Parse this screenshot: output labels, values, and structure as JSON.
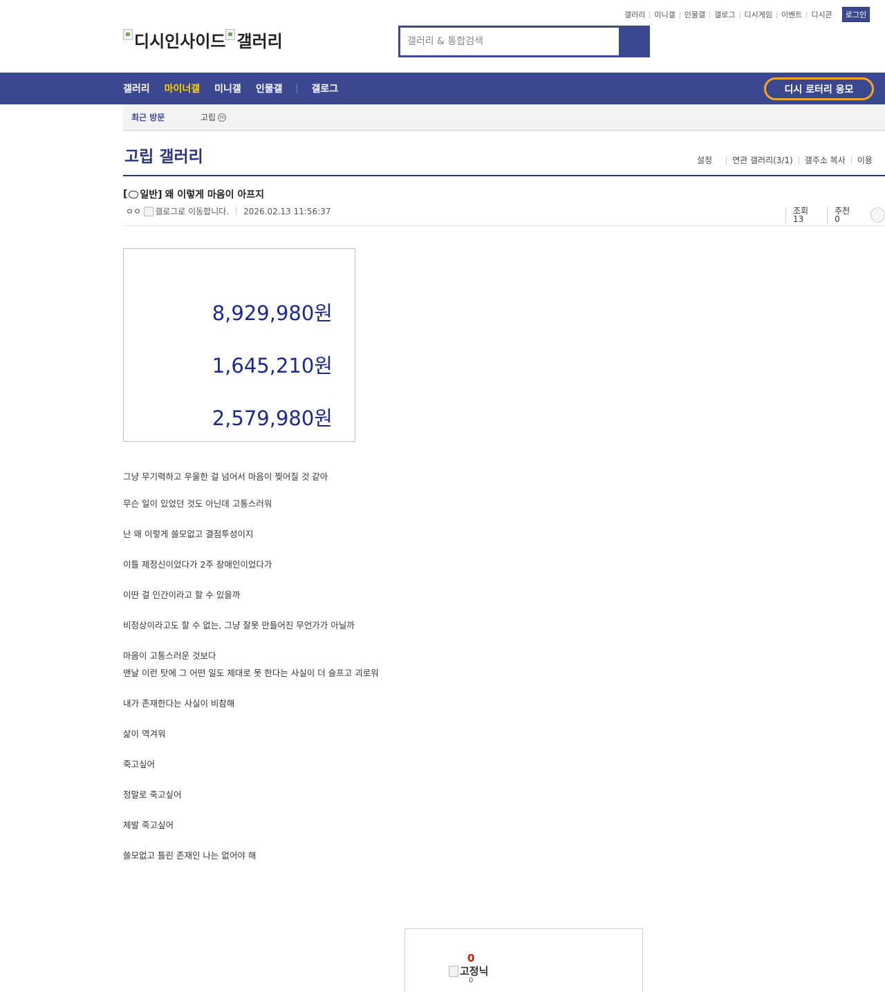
{
  "top_links": [
    "갤러리",
    "미니갤",
    "인물갤",
    "갤로그",
    "디시게임",
    "이벤트",
    "디시콘"
  ],
  "login_label": "로그인",
  "logo": {
    "site": "디시인사이드",
    "section": "갤러리"
  },
  "search": {
    "placeholder": "갤러리 & 통합검색"
  },
  "nav": {
    "items": [
      "갤러리",
      "마이너갤",
      "미니갤",
      "인물갤"
    ],
    "gallog": "갤로그",
    "lottery": "디시 로터리 응모"
  },
  "recent": {
    "label": "최근 방문",
    "item": "고립",
    "badge": "m"
  },
  "gallery": {
    "title": "고립 갤러리",
    "tools": [
      "설정",
      "연관 갤러리(3/1)",
      "갤주소 복사",
      "이용"
    ]
  },
  "post": {
    "category_open": "[",
    "category": "일반]",
    "title": "왜 이렇게 마음이 아프지",
    "writer": "ㅇㅇ",
    "gallog_alt": "갤로그로 이동합니다.",
    "date": "2026.02.13 11:56:37",
    "views": "조회 13",
    "recommend": "추천 0"
  },
  "image_amounts": [
    "8,929,980원",
    "1,645,210원",
    "2,579,980원"
  ],
  "body_lines": [
    "그냥 무기력하고 우울한 걸 넘어서 마음이 찢어질 것 같아",
    "무슨 일이 있었던 것도 아닌데 고통스러워",
    "난 왜 이렇게 쓸모없고 결점투성이지",
    "이틀 제정신이었다가 2주 장애인이었다가",
    "이딴 걸 인간이라고 할 수 있을까",
    "비정상이라고도 할 수 없는, 그냥 잘못 만들어진 무언가가 아닐까",
    "마음이 고통스러운 것보다",
    "맨날 이런 탓에 그 어떤 일도 제대로 못 한다는 사실이 더 슬프고 괴로워",
    "내가 존재한다는 사실이 비참해",
    "삶이 역겨워",
    "죽고싶어",
    "정말로 죽고싶어",
    "제발 죽고싶어",
    "쓸모없고 틀린 존재인 나는 없어야 해"
  ],
  "recommend_box": {
    "count": "0",
    "fixed_label": "고정닉",
    "fixed_count": "0"
  }
}
